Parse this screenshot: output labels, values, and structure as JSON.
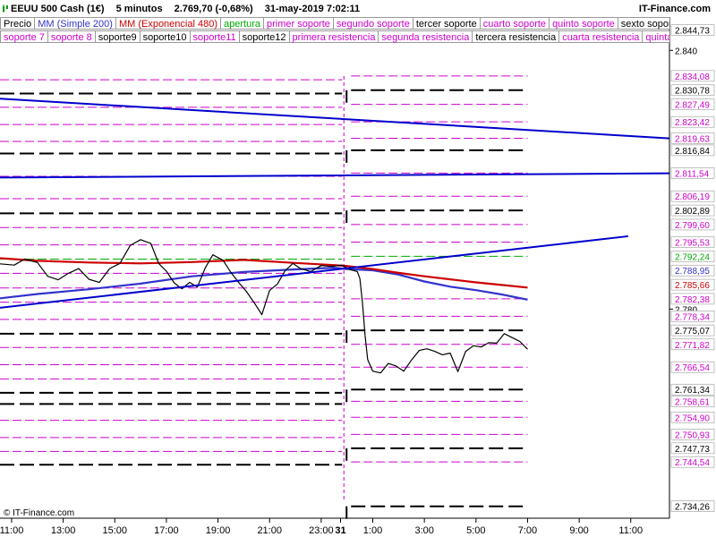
{
  "header": {
    "instrument": "EEUU 500 Cash (1€)",
    "timeframe": "5 minutos",
    "price_change": "2.769,70 (-0,68%)",
    "datetime": "31-may-2019 7:02:11",
    "brand": "IT-Finance.com"
  },
  "footer": {
    "copyright": "© IT-Finance.com"
  },
  "legend_row1": [
    {
      "label": "Precio",
      "color": "#000000"
    },
    {
      "label": "MM (Simple 200)",
      "color": "#3333cc"
    },
    {
      "label": "MM (Exponencial 480)",
      "color": "#cc0000"
    },
    {
      "label": "apertura",
      "color": "#00aa00"
    },
    {
      "label": "primer soporte",
      "color": "#cc00cc"
    },
    {
      "label": "segundo soporte",
      "color": "#cc00cc"
    },
    {
      "label": "tercer soporte",
      "color": "#000000"
    },
    {
      "label": "cuarto soporte",
      "color": "#cc00cc"
    },
    {
      "label": "quinto soporte",
      "color": "#cc00cc"
    },
    {
      "label": "sexto soporte",
      "color": "#000000"
    }
  ],
  "legend_row2": [
    {
      "label": "soporte 7",
      "color": "#cc00cc"
    },
    {
      "label": "soporte 8",
      "color": "#cc00cc"
    },
    {
      "label": "soporte9",
      "color": "#000000"
    },
    {
      "label": "soporte10",
      "color": "#000000"
    },
    {
      "label": "soporte11",
      "color": "#cc00cc"
    },
    {
      "label": "soporte12",
      "color": "#000000"
    },
    {
      "label": "primera resistencia",
      "color": "#cc00cc"
    },
    {
      "label": "segunda resistencia",
      "color": "#cc00cc"
    },
    {
      "label": "tercera resistencia",
      "color": "#000000"
    },
    {
      "label": "cuarta resistencia",
      "color": "#cc00cc"
    },
    {
      "label": "quinta resistencia",
      "color": "#cc00cc"
    }
  ],
  "chart_data": {
    "type": "line",
    "ylim": [
      2731.5,
      2846.5
    ],
    "y_ticks": [
      2840,
      2780
    ],
    "x_ticks": [
      {
        "label": "11:00",
        "t": -20
      },
      {
        "label": "13:00",
        "t": -18
      },
      {
        "label": "15:00",
        "t": -16
      },
      {
        "label": "17:00",
        "t": -14
      },
      {
        "label": "19:00",
        "t": -12
      },
      {
        "label": "21:00",
        "t": -10
      },
      {
        "label": "23:00",
        "t": -8
      },
      {
        "label": "31",
        "t": -7.25,
        "bold": true
      },
      {
        "label": "1:00",
        "t": -6
      },
      {
        "label": "3:00",
        "t": -4
      },
      {
        "label": "5:00",
        "t": -2
      },
      {
        "label": "7:00",
        "t": 0
      },
      {
        "label": "9:00",
        "t": 2
      },
      {
        "label": "11:00",
        "t": 4
      }
    ],
    "xlim": [
      -20.45,
      5.5
    ],
    "day_split": -7.12,
    "level_labels": [
      {
        "value": 2844.73,
        "label": "2.844,73",
        "color": "#000000"
      },
      {
        "value": 2834.08,
        "label": "2.834,08",
        "color": "#cc00cc"
      },
      {
        "value": 2830.78,
        "label": "2.830,78",
        "color": "#000000"
      },
      {
        "value": 2827.49,
        "label": "2.827,49",
        "color": "#cc00cc"
      },
      {
        "value": 2823.42,
        "label": "2.823,42",
        "color": "#cc00cc"
      },
      {
        "value": 2819.63,
        "label": "2.819,63",
        "color": "#cc00cc"
      },
      {
        "value": 2816.84,
        "label": "2.816,84",
        "color": "#000000"
      },
      {
        "value": 2811.54,
        "label": "2.811,54",
        "color": "#cc00cc"
      },
      {
        "value": 2806.19,
        "label": "2.806,19",
        "color": "#cc00cc"
      },
      {
        "value": 2802.89,
        "label": "2.802,89",
        "color": "#000000"
      },
      {
        "value": 2799.6,
        "label": "2.799,60",
        "color": "#cc00cc"
      },
      {
        "value": 2795.53,
        "label": "2.795,53",
        "color": "#cc00cc"
      },
      {
        "value": 2792.24,
        "label": "2.792,24",
        "color": "#00aa00"
      },
      {
        "value": 2788.95,
        "label": "2.788,95",
        "color": "#3333cc"
      },
      {
        "value": 2785.66,
        "label": "2.785,66",
        "color": "#cc0000"
      },
      {
        "value": 2782.38,
        "label": "2.782,38",
        "color": "#cc00cc"
      },
      {
        "value": 2778.34,
        "label": "2.778,34",
        "color": "#cc00cc"
      },
      {
        "value": 2775.07,
        "label": "2.775,07",
        "color": "#000000"
      },
      {
        "value": 2771.82,
        "label": "2.771,82",
        "color": "#cc00cc"
      },
      {
        "value": 2766.54,
        "label": "2.766,54",
        "color": "#cc00cc"
      },
      {
        "value": 2761.34,
        "label": "2.761,34",
        "color": "#000000"
      },
      {
        "value": 2758.61,
        "label": "2.758,61",
        "color": "#cc00cc"
      },
      {
        "value": 2754.9,
        "label": "2.754,90",
        "color": "#cc00cc"
      },
      {
        "value": 2750.93,
        "label": "2.750,93",
        "color": "#cc00cc"
      },
      {
        "value": 2747.73,
        "label": "2.747,73",
        "color": "#000000"
      },
      {
        "value": 2744.54,
        "label": "2.744,54",
        "color": "#cc00cc"
      },
      {
        "value": 2734.26,
        "label": "2.734,26",
        "color": "#000000"
      }
    ],
    "levels_prev_day": [
      {
        "value": 2842.6,
        "color": "#000000"
      },
      {
        "value": 2833.2,
        "color": "#cc00cc"
      },
      {
        "value": 2830.0,
        "color": "#000000"
      },
      {
        "value": 2826.8,
        "color": "#cc00cc"
      },
      {
        "value": 2822.8,
        "color": "#cc00cc"
      },
      {
        "value": 2818.9,
        "color": "#cc00cc"
      },
      {
        "value": 2816.1,
        "color": "#000000"
      },
      {
        "value": 2810.8,
        "color": "#cc00cc"
      },
      {
        "value": 2805.6,
        "color": "#cc00cc"
      },
      {
        "value": 2802.2,
        "color": "#000000"
      },
      {
        "value": 2798.9,
        "color": "#cc00cc"
      },
      {
        "value": 2794.9,
        "color": "#cc00cc"
      },
      {
        "value": 2791.6,
        "color": "#00aa00"
      },
      {
        "value": 2788.3,
        "color": "#cc00cc"
      },
      {
        "value": 2784.9,
        "color": "#cc00cc"
      },
      {
        "value": 2781.6,
        "color": "#cc00cc"
      },
      {
        "value": 2777.6,
        "color": "#cc00cc"
      },
      {
        "value": 2774.3,
        "color": "#000000"
      },
      {
        "value": 2771.1,
        "color": "#cc00cc"
      },
      {
        "value": 2767.1,
        "color": "#cc00cc"
      },
      {
        "value": 2763.8,
        "color": "#cc00cc"
      },
      {
        "value": 2760.6,
        "color": "#000000"
      },
      {
        "value": 2758.0,
        "color": "#000000"
      },
      {
        "value": 2754.2,
        "color": "#cc00cc"
      },
      {
        "value": 2750.2,
        "color": "#cc00cc"
      },
      {
        "value": 2747.0,
        "color": "#cc00cc"
      },
      {
        "value": 2743.9,
        "color": "#000000"
      }
    ],
    "levels_today": [
      {
        "value": 2834.08,
        "color": "#cc00cc"
      },
      {
        "value": 2830.78,
        "color": "#000000"
      },
      {
        "value": 2827.49,
        "color": "#cc00cc"
      },
      {
        "value": 2823.42,
        "color": "#cc00cc"
      },
      {
        "value": 2819.63,
        "color": "#cc00cc"
      },
      {
        "value": 2816.84,
        "color": "#000000"
      },
      {
        "value": 2811.54,
        "color": "#cc00cc"
      },
      {
        "value": 2806.19,
        "color": "#cc00cc"
      },
      {
        "value": 2802.89,
        "color": "#000000"
      },
      {
        "value": 2799.6,
        "color": "#cc00cc"
      },
      {
        "value": 2795.53,
        "color": "#cc00cc"
      },
      {
        "value": 2792.24,
        "color": "#00aa00"
      },
      {
        "value": 2782.38,
        "color": "#cc00cc"
      },
      {
        "value": 2778.34,
        "color": "#cc00cc"
      },
      {
        "value": 2775.07,
        "color": "#000000"
      },
      {
        "value": 2771.82,
        "color": "#cc00cc"
      },
      {
        "value": 2766.54,
        "color": "#cc00cc"
      },
      {
        "value": 2761.34,
        "color": "#000000"
      },
      {
        "value": 2758.61,
        "color": "#cc00cc"
      },
      {
        "value": 2754.9,
        "color": "#cc00cc"
      },
      {
        "value": 2750.93,
        "color": "#cc00cc"
      },
      {
        "value": 2747.73,
        "color": "#000000"
      },
      {
        "value": 2744.54,
        "color": "#cc00cc"
      },
      {
        "value": 2734.26,
        "color": "#000000"
      }
    ],
    "trendlines": [
      {
        "from": [
          -20.45,
          2828.8
        ],
        "to": [
          5.5,
          2819.6
        ],
        "color": "#0000cc"
      },
      {
        "from": [
          -20.45,
          2810.5
        ],
        "to": [
          5.5,
          2811.5
        ],
        "color": "#0000cc"
      },
      {
        "from": [
          -20.45,
          2780.3
        ],
        "to": [
          3.9,
          2796.9
        ],
        "color": "#0000cc"
      }
    ],
    "series": [
      {
        "name": "MM (Simple 200)",
        "color": "#3333cc",
        "x": [
          -20.45,
          -19,
          -17,
          -15,
          -13,
          -11,
          -9,
          -7.5,
          -7,
          -6,
          -5,
          -4,
          -3,
          -2,
          -1,
          0
        ],
        "y": [
          2782.5,
          2783.5,
          2784.6,
          2785.9,
          2787.6,
          2788.6,
          2789.2,
          2789.6,
          2789.3,
          2789.0,
          2788.0,
          2786.4,
          2785.2,
          2784.4,
          2783.4,
          2782.2
        ]
      },
      {
        "name": "MM (Exponencial 480)",
        "color": "#cc0000",
        "x": [
          -20.45,
          -19,
          -17,
          -15,
          -13,
          -11,
          -9,
          -7.5,
          -7,
          -6,
          -5,
          -4,
          -3,
          -2,
          -1,
          0
        ],
        "y": [
          2791.8,
          2791.2,
          2790.8,
          2790.6,
          2790.9,
          2791.4,
          2790.7,
          2790.2,
          2790.0,
          2789.3,
          2788.4,
          2787.6,
          2786.9,
          2786.2,
          2785.6,
          2785.0
        ]
      },
      {
        "name": "Precio",
        "color": "#000000",
        "x": [
          -20.45,
          -19.9,
          -19.5,
          -19,
          -18.6,
          -18.2,
          -17.8,
          -17.4,
          -17.0,
          -16.6,
          -16.2,
          -15.8,
          -15.4,
          -15.0,
          -14.6,
          -14.3,
          -14.0,
          -13.7,
          -13.4,
          -13.1,
          -12.8,
          -12.5,
          -12.2,
          -11.8,
          -11.5,
          -11.2,
          -10.9,
          -10.6,
          -10.3,
          -10.0,
          -9.7,
          -9.4,
          -9.1,
          -8.8,
          -8.4,
          -8.0,
          -7.6,
          -7.2,
          -6.9,
          -6.6,
          -6.5,
          -6.4,
          -6.3,
          -6.2,
          -6.0,
          -5.7,
          -5.4,
          -5.1,
          -4.8,
          -4.5,
          -4.2,
          -3.9,
          -3.6,
          -3.3,
          -3.0,
          -2.7,
          -2.4,
          -2.1,
          -1.8,
          -1.5,
          -1.2,
          -0.9,
          -0.6,
          -0.3,
          0.0
        ],
        "y": [
          2790.5,
          2790.2,
          2791.6,
          2790.8,
          2787.6,
          2786.8,
          2788.3,
          2789.4,
          2786.9,
          2786.2,
          2789.4,
          2790.6,
          2794.8,
          2796.1,
          2795.2,
          2790.6,
          2788.8,
          2786.1,
          2784.7,
          2786.2,
          2785.1,
          2789.5,
          2792.6,
          2791.3,
          2788.5,
          2786.2,
          2784.1,
          2781.5,
          2778.7,
          2784.3,
          2785.8,
          2788.9,
          2790.6,
          2789.4,
          2788.7,
          2790.1,
          2789.9,
          2790.2,
          2789.2,
          2788.7,
          2787.1,
          2781.4,
          2773.9,
          2768.3,
          2765.6,
          2765.2,
          2767.4,
          2766.8,
          2765.6,
          2768.2,
          2770.4,
          2770.8,
          2770.2,
          2769.4,
          2769.8,
          2765.5,
          2770.2,
          2771.5,
          2771.2,
          2772.2,
          2772.1,
          2774.3,
          2773.4,
          2772.5,
          2770.7
        ]
      }
    ]
  }
}
